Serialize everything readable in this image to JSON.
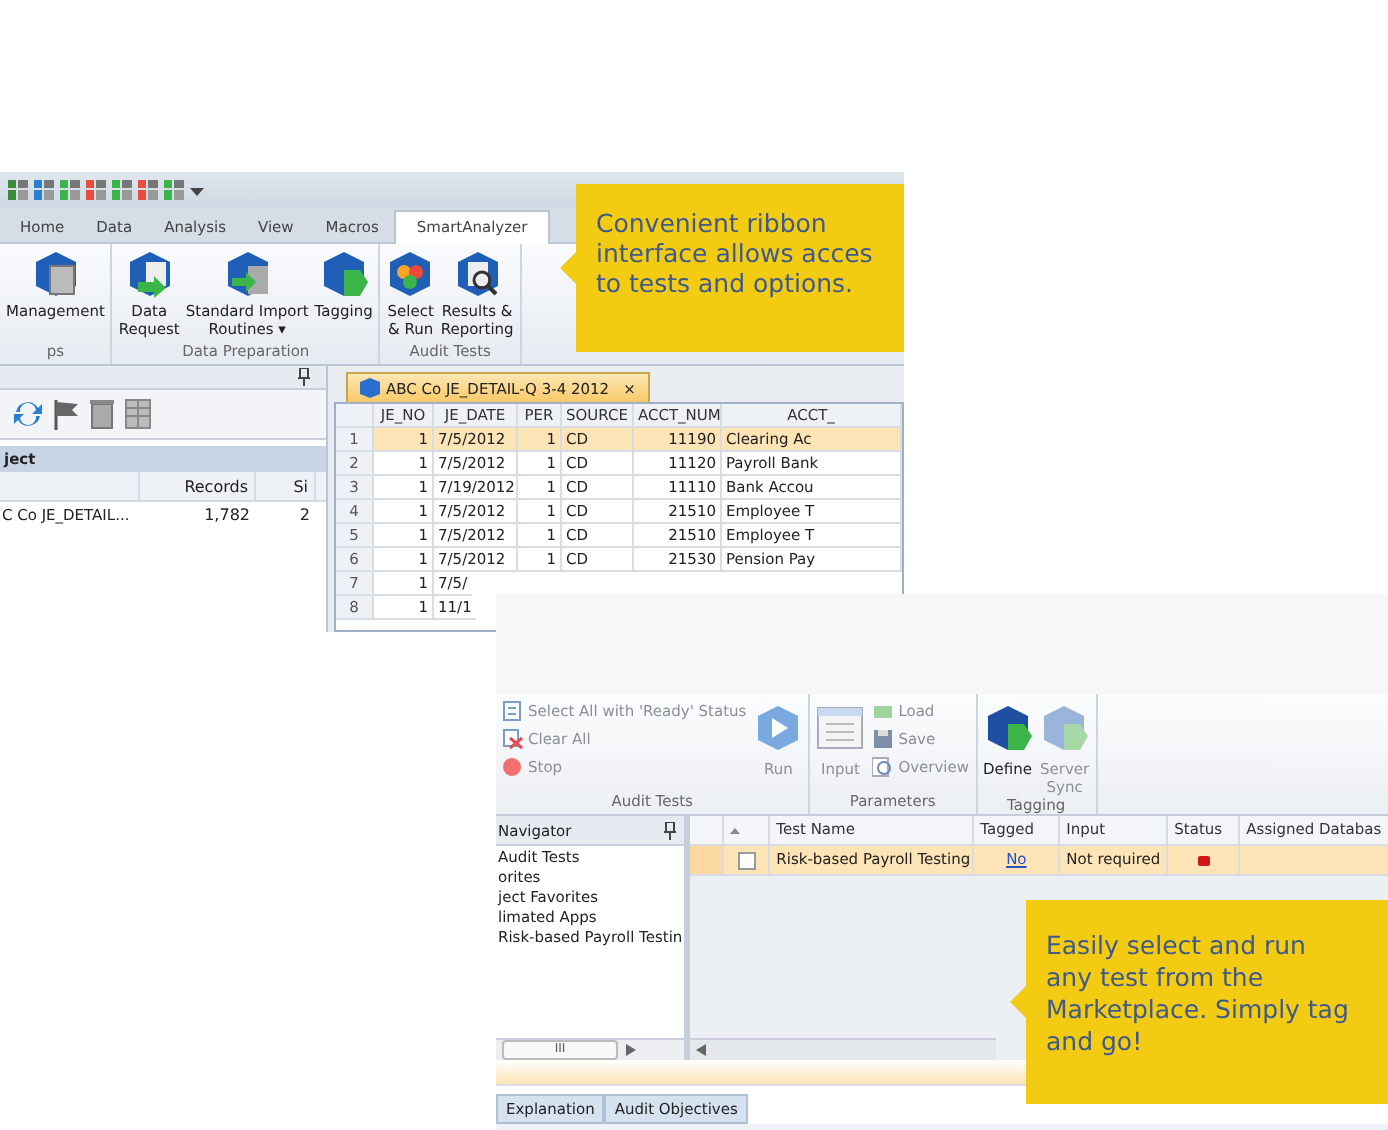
{
  "ribbon_window": {
    "tabs": [
      {
        "label": "Home",
        "selected": false
      },
      {
        "label": "Data",
        "selected": false
      },
      {
        "label": "Analysis",
        "selected": false
      },
      {
        "label": "View",
        "selected": false
      },
      {
        "label": "Macros",
        "selected": false
      },
      {
        "label": "SmartAnalyzer",
        "selected": true
      }
    ],
    "ribbon_groups": [
      {
        "label": "ps",
        "buttons": [
          {
            "label": "Management"
          }
        ]
      },
      {
        "label": "Data Preparation",
        "buttons": [
          {
            "label": "Data\nRequest"
          },
          {
            "label": "Standard Import\nRoutines ▾"
          },
          {
            "label": "Tagging"
          }
        ]
      },
      {
        "label": "Audit Tests",
        "buttons": [
          {
            "label": "Select\n& Run"
          },
          {
            "label": "Results &\nReporting"
          }
        ]
      }
    ],
    "left_panel": {
      "section": "ject",
      "columns": [
        "",
        "Records",
        "Si"
      ],
      "rows": [
        [
          "C Co JE_DETAIL...",
          "1,782",
          "2"
        ]
      ]
    },
    "document_tab": {
      "label": "ABC Co JE_DETAIL-Q 3-4 2012",
      "close": "×"
    },
    "table": {
      "columns": [
        "JE_NO",
        "JE_DATE",
        "PER",
        "SOURCE",
        "ACCT_NUM",
        "ACCT_"
      ],
      "rows": [
        {
          "number": "1",
          "selected": true,
          "cells": [
            "1",
            "7/5/2012",
            "1",
            "CD",
            "11190",
            "Clearing Ac"
          ]
        },
        {
          "number": "2",
          "selected": false,
          "cells": [
            "1",
            "7/5/2012",
            "1",
            "CD",
            "11120",
            "Payroll Bank"
          ]
        },
        {
          "number": "3",
          "selected": false,
          "cells": [
            "1",
            "7/19/2012",
            "1",
            "CD",
            "11110",
            "Bank Accou"
          ]
        },
        {
          "number": "4",
          "selected": false,
          "cells": [
            "1",
            "7/5/2012",
            "1",
            "CD",
            "21510",
            "Employee T"
          ]
        },
        {
          "number": "5",
          "selected": false,
          "cells": [
            "1",
            "7/5/2012",
            "1",
            "CD",
            "21510",
            "Employee T"
          ]
        },
        {
          "number": "6",
          "selected": false,
          "cells": [
            "1",
            "7/5/2012",
            "1",
            "CD",
            "21530",
            "Pension Pay"
          ]
        },
        {
          "number": "7",
          "selected": false,
          "cells": [
            "1",
            "7/5/"
          ]
        },
        {
          "number": "8",
          "selected": false,
          "cells": [
            "1",
            "11/1"
          ]
        }
      ]
    }
  },
  "marketplace_window": {
    "command_groups": [
      {
        "label": "Audit Tests",
        "buttons": [
          {
            "kind": "small",
            "label": "Select All with 'Ready' Status",
            "disabled": true
          },
          {
            "kind": "small",
            "label": "Clear All",
            "disabled": true
          },
          {
            "kind": "small",
            "label": "Stop",
            "disabled": true
          },
          {
            "kind": "large",
            "label": "Run",
            "disabled": true
          }
        ]
      },
      {
        "label": "Parameters",
        "buttons": [
          {
            "kind": "large",
            "label": "Input",
            "disabled": true
          },
          {
            "kind": "small",
            "label": "Load",
            "disabled": true
          },
          {
            "kind": "small",
            "label": "Save",
            "disabled": true
          },
          {
            "kind": "small",
            "label": "Overview",
            "disabled": true
          }
        ]
      },
      {
        "label": "Tagging",
        "buttons": [
          {
            "kind": "large",
            "label": "Define",
            "disabled": false
          },
          {
            "kind": "large",
            "label": "Server\nSync",
            "disabled": true
          }
        ]
      }
    ],
    "navigator": {
      "title": "Navigator",
      "items": [
        "Audit Tests",
        "orites",
        "ject Favorites",
        "limated Apps",
        "Risk-based Payroll Testin"
      ],
      "scroll_grip": "III"
    },
    "grid": {
      "columns": [
        "Test Name",
        "Tagged",
        "Input",
        "Status",
        "Assigned Databas"
      ],
      "rows": [
        {
          "selected": true,
          "checked": false,
          "test_name": "Risk-based Payroll Testing",
          "tagged": "No",
          "input": "Not required",
          "color": "#d01818"
        }
      ]
    },
    "bottom_tabs": [
      {
        "label": "Explanation",
        "selected": false
      },
      {
        "label": "Audit Objectives",
        "selected": false
      }
    ]
  },
  "callouts": [
    {
      "text": "Convenient ribbon\ninterface allows acces\nto tests and options."
    },
    {
      "text": "Easily select and run\nany test from the\nMarketplace. Simply tag\nand go!"
    }
  ]
}
